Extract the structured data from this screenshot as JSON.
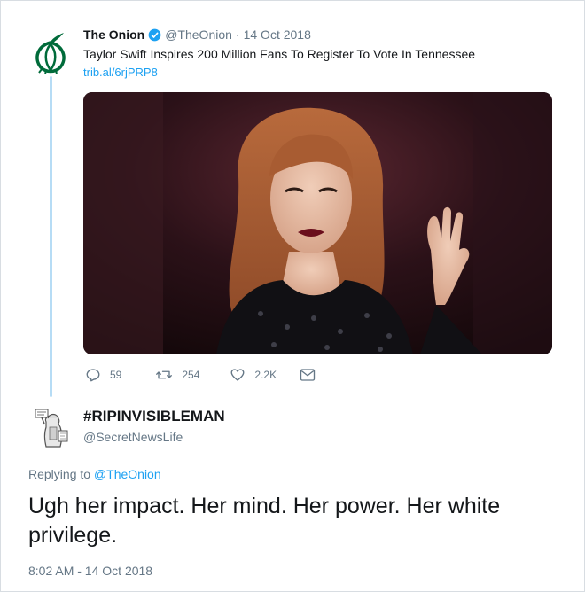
{
  "tweet1": {
    "name": "The Onion",
    "handle": "@TheOnion",
    "separator": "·",
    "date": "14 Oct 2018",
    "text": "Taylor Swift Inspires 200 Million Fans To Register To Vote In Tennessee",
    "link": "trib.al/6rjPRP8",
    "avatar_icon": "onion-logo-icon",
    "verified_icon": "verified-badge-icon",
    "actions": {
      "reply_count": "59",
      "retweet_count": "254",
      "like_count": "2.2K"
    }
  },
  "tweet2": {
    "name": "#RIPINVISIBLEMAN",
    "handle": "@SecretNewsLife",
    "replying_prefix": "Replying to",
    "replying_to": "@TheOnion",
    "text": "Ugh her impact. Her mind. Her power. Her white privilege.",
    "timestamp": "8:02 AM - 14 Oct 2018"
  },
  "colors": {
    "link": "#1da1f2",
    "muted": "#657786",
    "text": "#14171a",
    "thread_line": "#b6dcf5",
    "onion_green": "#006b3a"
  }
}
